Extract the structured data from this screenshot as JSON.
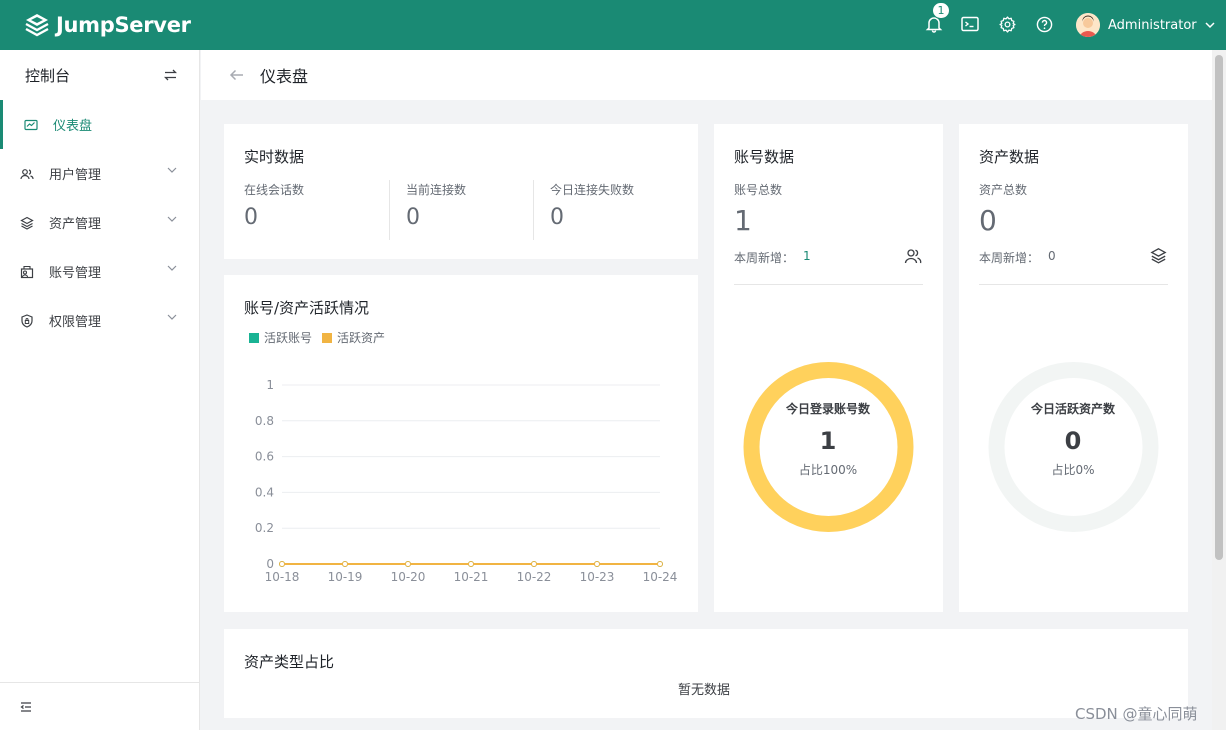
{
  "topbar": {
    "logo_text": "JumpServer",
    "notification_count": "1",
    "user_name": "Administrator",
    "bg_color": "#1a8a74"
  },
  "sidebar": {
    "header": "控制台",
    "items": [
      {
        "label": "仪表盘",
        "icon": "dashboard-icon",
        "active": true
      },
      {
        "label": "用户管理",
        "icon": "users-icon",
        "has_children": true
      },
      {
        "label": "资产管理",
        "icon": "layers-icon",
        "has_children": true
      },
      {
        "label": "账号管理",
        "icon": "account-icon",
        "has_children": true
      },
      {
        "label": "权限管理",
        "icon": "shield-icon",
        "has_children": true
      }
    ]
  },
  "page": {
    "title": "仪表盘"
  },
  "realtime": {
    "title": "实时数据",
    "stats": [
      {
        "label": "在线会话数",
        "value": "0"
      },
      {
        "label": "当前连接数",
        "value": "0"
      },
      {
        "label": "今日连接失败数",
        "value": "0"
      }
    ]
  },
  "accounts": {
    "title": "账号数据",
    "total_label": "账号总数",
    "total_value": "1",
    "weekly_label": "本周新增：",
    "weekly_value": "1",
    "ring_caption": "今日登录账号数",
    "ring_value": "1",
    "ring_percent": "占比100%",
    "ring_fraction": 1.0,
    "ring_color": "#ffd15c"
  },
  "assets": {
    "title": "资产数据",
    "total_label": "资产总数",
    "total_value": "0",
    "weekly_label": "本周新增：",
    "weekly_value": "0",
    "ring_caption": "今日活跃资产数",
    "ring_value": "0",
    "ring_percent": "占比0%",
    "ring_fraction": 0.0,
    "ring_color": "#f2f5f4"
  },
  "activity": {
    "title": "账号/资产活跃情况"
  },
  "chart_data": {
    "type": "line",
    "x": [
      "10-18",
      "10-19",
      "10-20",
      "10-21",
      "10-22",
      "10-23",
      "10-24"
    ],
    "series": [
      {
        "name": "活跃账号",
        "values": [
          0,
          0,
          0,
          0,
          0,
          0,
          0
        ],
        "color": "#1ab394"
      },
      {
        "name": "活跃资产",
        "values": [
          0,
          0,
          0,
          0,
          0,
          0,
          0
        ],
        "color": "#f1b443"
      }
    ],
    "ylim": [
      0,
      1
    ],
    "yticks": [
      "1",
      "0.8",
      "0.6",
      "0.4",
      "0.2",
      "0"
    ],
    "grid": true,
    "legend": "top-left"
  },
  "asset_types": {
    "title": "资产类型占比",
    "empty_text": "暂无数据"
  },
  "watermark": "CSDN @童心同萌"
}
